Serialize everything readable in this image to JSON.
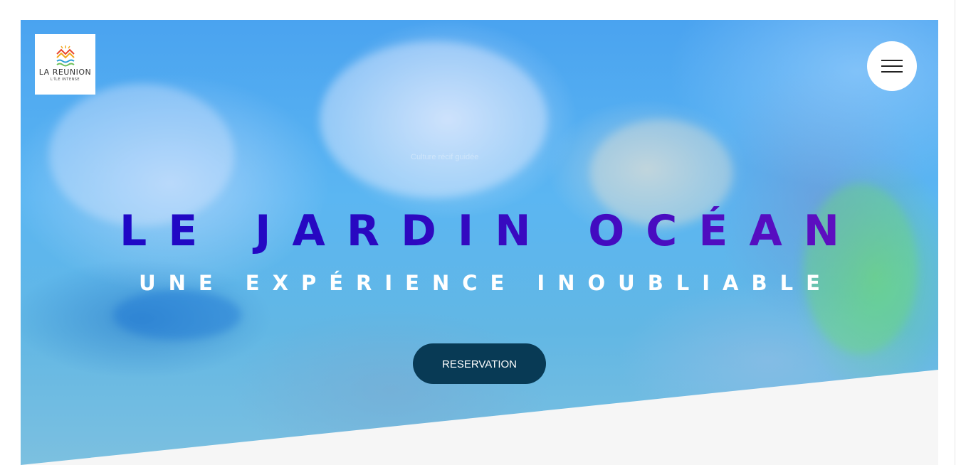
{
  "logo": {
    "name": "LA REUNION",
    "tagline": "L'ÎLE INTENSE",
    "colors": [
      "#e8452c",
      "#f2a81d",
      "#2a9fd6",
      "#6bbf59"
    ]
  },
  "nav": {
    "menu_icon": "hamburger-menu-icon"
  },
  "hero": {
    "faint_caption": "Culture récif guidée",
    "title": "LE JARDIN OCÉAN",
    "subtitle": "UNE EXPÉRIENCE INOUBLIABLE",
    "cta_label": "RESERVATION",
    "colors": {
      "title_start": "#1a08c8",
      "title_end": "#6a10c0",
      "cta_background": "#083a55",
      "slant_fill": "#f6f6f6"
    }
  }
}
